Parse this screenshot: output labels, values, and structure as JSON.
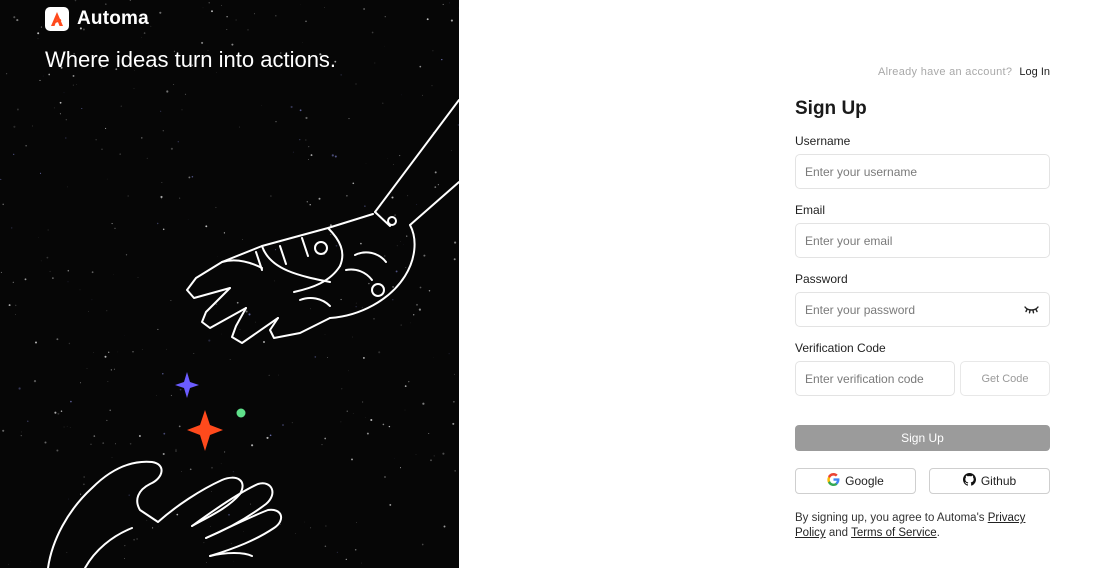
{
  "brand": {
    "name": "Automa",
    "tagline": "Where ideas turn into actions."
  },
  "header": {
    "already_text": "Already have an account?",
    "login_label": "Log In"
  },
  "form": {
    "title": "Sign Up",
    "username": {
      "label": "Username",
      "placeholder": "Enter your username"
    },
    "email": {
      "label": "Email",
      "placeholder": "Enter your email"
    },
    "password": {
      "label": "Password",
      "placeholder": "Enter your password"
    },
    "verification": {
      "label": "Verification Code",
      "placeholder": "Enter verification code",
      "button": "Get Code"
    },
    "submit_label": "Sign Up",
    "google_label": "Google",
    "github_label": "Github"
  },
  "terms": {
    "prefix": "By signing up, you agree to Automa's ",
    "privacy": "Privacy Policy",
    "and": " and ",
    "tos": "Terms of Service",
    "suffix": "."
  },
  "colors": {
    "accent": "#ff4a1c",
    "left_bg": "#060606",
    "button_disabled": "#9b9b9b",
    "sparkle_purple": "#6b5cff",
    "sparkle_orange": "#ff4a1c",
    "dot_green": "#5fe08a"
  },
  "icons": [
    "automa-logo-icon",
    "eye-closed-icon",
    "google-icon",
    "github-icon",
    "sparkle-icon"
  ]
}
